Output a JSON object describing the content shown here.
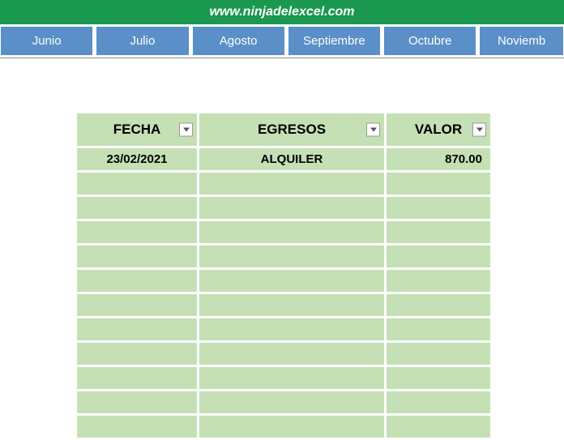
{
  "header": {
    "url": "www.ninjadelexcel.com"
  },
  "tabs": [
    "Junio",
    "Julio",
    "Agosto",
    "Septiembre",
    "Octubre",
    "Noviemb"
  ],
  "table": {
    "headers": {
      "fecha": "FECHA",
      "egresos": "EGRESOS",
      "valor": "VALOR"
    },
    "rows": [
      {
        "fecha": "23/02/2021",
        "egresos": "ALQUILER",
        "valor": "870.00"
      }
    ],
    "empty_rows_count": 11
  }
}
